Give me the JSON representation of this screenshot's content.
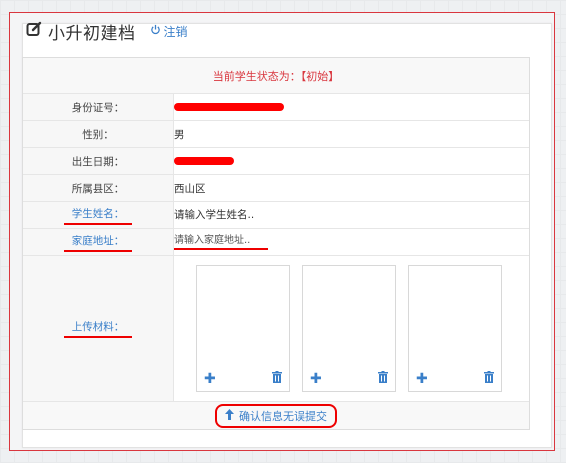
{
  "header": {
    "title": "小升初建档",
    "logout_label": "注销"
  },
  "status": {
    "text": "当前学生状态为：【初始】"
  },
  "rows": {
    "id_label": "身份证号：",
    "gender_label": "性别：",
    "gender_value": "男",
    "birth_label": "出生日期：",
    "district_label": "所属县区：",
    "district_value": "西山区",
    "name_label": "学生姓名：",
    "name_placeholder": "请输入学生姓名..",
    "address_label": "家庭地址：",
    "address_placeholder": "请输入家庭地址..",
    "upload_label": "上传材料："
  },
  "submit": {
    "label": "确认信息无误提交"
  },
  "colors": {
    "accent": "#3a7fc9",
    "alert": "#d9363e",
    "redaction": "#ff0000"
  }
}
